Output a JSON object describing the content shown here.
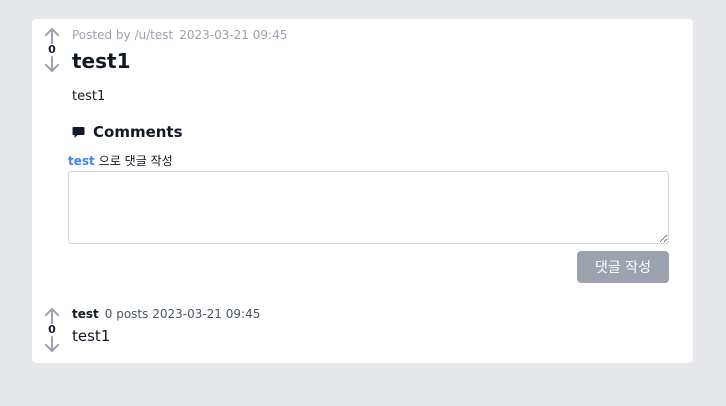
{
  "post": {
    "score": "0",
    "posted_by": "Posted by /u/test",
    "date": "2023-03-21 09:45",
    "title": "test1",
    "body": "test1"
  },
  "comments": {
    "heading": "Comments",
    "commenting_user": "test",
    "commenting_as_suffix": "으로 댓글 작성",
    "input_value": "",
    "submit_label": "댓글 작성",
    "items": [
      {
        "score": "0",
        "author": "test",
        "meta": "0 posts 2023-03-21 09:45",
        "body": "test1"
      }
    ]
  },
  "colors": {
    "background": "#e5e7eb",
    "card": "#ffffff",
    "vote_arrow": "#9ca3af",
    "user_link": "#3b82f6",
    "button_disabled": "#9ca3af"
  }
}
